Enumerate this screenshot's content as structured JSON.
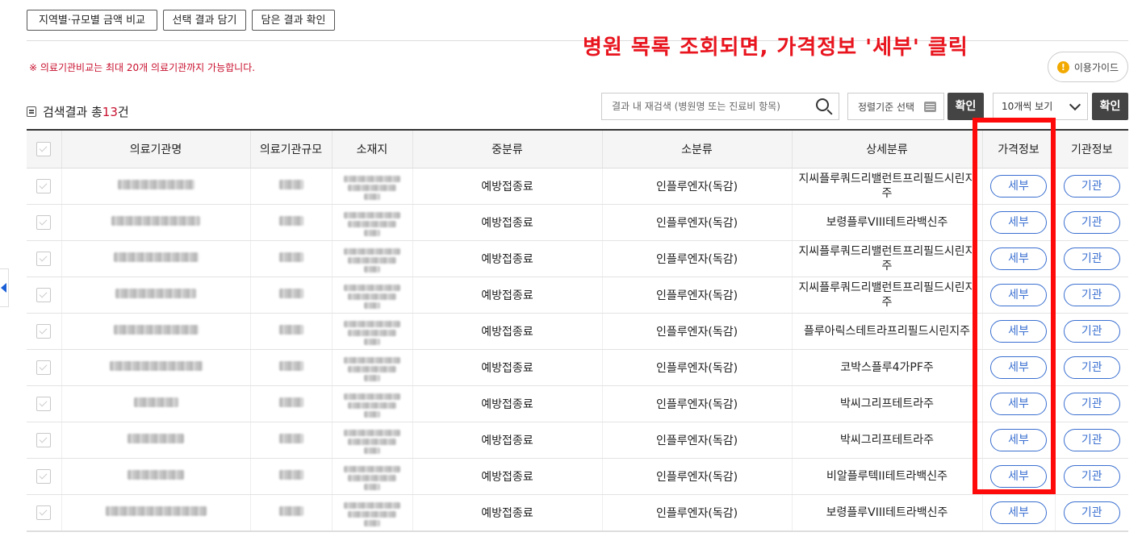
{
  "top_buttons": [
    "지역별·규모별 금액 비교",
    "선택 결과 담기",
    "담은 결과 확인"
  ],
  "notice": "※ 의료기관비교는 최대 20개 의료기관까지 가능합니다.",
  "annotation": "병원 목록 조회되면, 가격정보 '세부' 클릭",
  "guide": {
    "icon": "exclamation-icon",
    "label": "이용가이드"
  },
  "results": {
    "prefix": "검색결과 총",
    "count": "13",
    "suffix": "건"
  },
  "search": {
    "placeholder": "결과 내 재검색 (병원명 또는 진료비 항목)"
  },
  "sort": {
    "label": "정렬기준 선택"
  },
  "confirm1": "확인",
  "page_size": {
    "selected": "10개씩 보기"
  },
  "confirm2": "확인",
  "headers": [
    "",
    "의료기관명",
    "의료기관규모",
    "소재지",
    "중분류",
    "소분류",
    "상세분류",
    "가격정보",
    "기관정보"
  ],
  "rows": [
    {
      "mid": "예방접종료",
      "sub": "인플루엔자(독감)",
      "detail": "지씨플루쿼드리밸런트프리필드시린지주",
      "price": "세부",
      "org": "기관"
    },
    {
      "mid": "예방접종료",
      "sub": "인플루엔자(독감)",
      "detail": "보령플루VIII테트라백신주",
      "price": "세부",
      "org": "기관"
    },
    {
      "mid": "예방접종료",
      "sub": "인플루엔자(독감)",
      "detail": "지씨플루쿼드리밸런트프리필드시린지주",
      "price": "세부",
      "org": "기관"
    },
    {
      "mid": "예방접종료",
      "sub": "인플루엔자(독감)",
      "detail": "지씨플루쿼드리밸런트프리필드시린지주",
      "price": "세부",
      "org": "기관"
    },
    {
      "mid": "예방접종료",
      "sub": "인플루엔자(독감)",
      "detail": "플루아릭스테트라프리필드시린지주",
      "price": "세부",
      "org": "기관"
    },
    {
      "mid": "예방접종료",
      "sub": "인플루엔자(독감)",
      "detail": "코박스플루4가PF주",
      "price": "세부",
      "org": "기관"
    },
    {
      "mid": "예방접종료",
      "sub": "인플루엔자(독감)",
      "detail": "박씨그리프테트라주",
      "price": "세부",
      "org": "기관"
    },
    {
      "mid": "예방접종료",
      "sub": "인플루엔자(독감)",
      "detail": "박씨그리프테트라주",
      "price": "세부",
      "org": "기관"
    },
    {
      "mid": "예방접종료",
      "sub": "인플루엔자(독감)",
      "detail": "비알플루텍II테트라백신주",
      "price": "세부",
      "org": "기관"
    },
    {
      "mid": "예방접종료",
      "sub": "인플루엔자(독감)",
      "detail": "보령플루VIII테트라백신주",
      "price": "세부",
      "org": "기관"
    }
  ]
}
